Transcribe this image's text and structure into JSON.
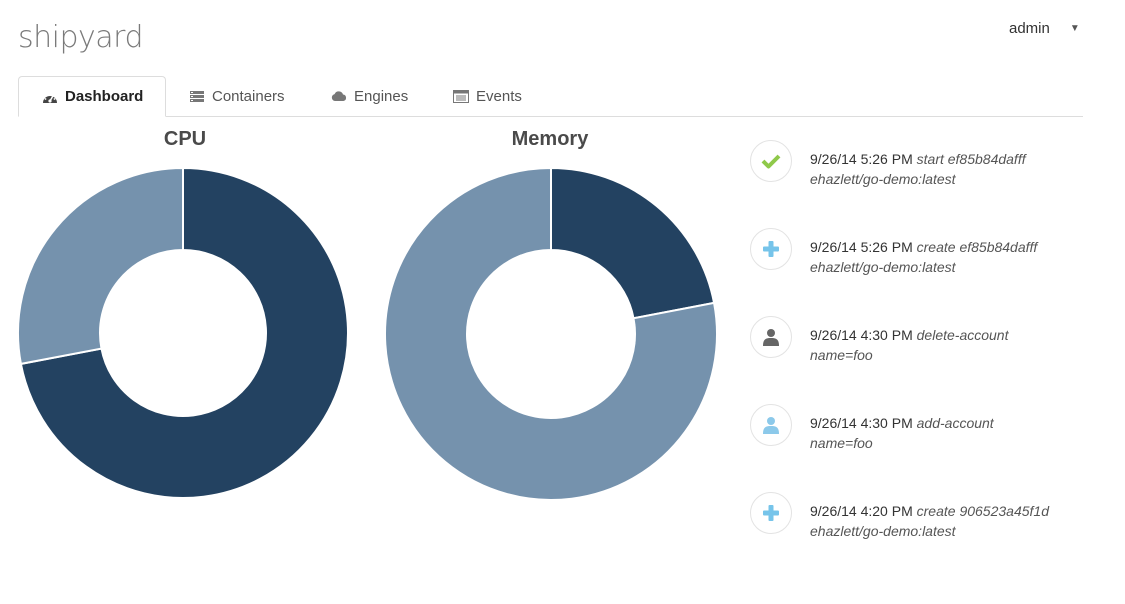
{
  "app": {
    "logo": "shipyard"
  },
  "user_menu": {
    "label": "admin"
  },
  "tabs": [
    {
      "label": "Dashboard",
      "icon": "dashboard-icon",
      "active": true
    },
    {
      "label": "Containers",
      "icon": "containers-icon",
      "active": false
    },
    {
      "label": "Engines",
      "icon": "cloud-icon",
      "active": false
    },
    {
      "label": "Events",
      "icon": "events-icon",
      "active": false
    }
  ],
  "colors": {
    "dark": "#234261",
    "light": "#7592ad",
    "check": "#8fc94a",
    "plus": "#76c4ea",
    "user": "#666666",
    "user_light": "#8cc9ea"
  },
  "chart_data": [
    {
      "type": "pie",
      "title": "CPU",
      "slices": [
        {
          "value": 72,
          "color": "#234261"
        },
        {
          "value": 28,
          "color": "#7592ad"
        }
      ]
    },
    {
      "type": "pie",
      "title": "Memory",
      "slices": [
        {
          "value": 22,
          "color": "#234261"
        },
        {
          "value": 78,
          "color": "#7592ad"
        }
      ]
    }
  ],
  "events": [
    {
      "time": "9/26/14 5:26 PM",
      "action": "start ef85b84dafff",
      "detail": "ehazlett/go-demo:latest",
      "icon": "check-icon"
    },
    {
      "time": "9/26/14 5:26 PM",
      "action": "create ef85b84dafff",
      "detail": "ehazlett/go-demo:latest",
      "icon": "plus-icon"
    },
    {
      "time": "9/26/14 4:30 PM",
      "action": "delete-account",
      "detail": "name=foo",
      "icon": "user-icon"
    },
    {
      "time": "9/26/14 4:30 PM",
      "action": "add-account",
      "detail": "name=foo",
      "icon": "user-add-icon"
    },
    {
      "time": "9/26/14 4:20 PM",
      "action": "create 906523a45f1d",
      "detail": "ehazlett/go-demo:latest",
      "icon": "plus-icon"
    }
  ]
}
